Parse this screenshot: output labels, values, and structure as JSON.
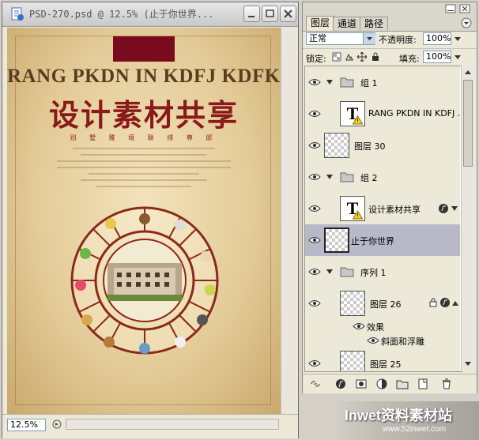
{
  "document": {
    "title": "PSD-270.psd @ 12.5% (止于你世界...",
    "zoom": "12.5%",
    "poster": {
      "english_title": "RANG PKDN IN KDFJ  KDFKD",
      "chinese_title": "设计素材共享",
      "subtitle": "别 墅 雅 境  联 排 尊 邸"
    }
  },
  "panel": {
    "tabs": [
      {
        "label": "图层"
      },
      {
        "label": "通道"
      },
      {
        "label": "路径"
      }
    ],
    "blend_mode": "正常",
    "opacity_label": "不透明度:",
    "opacity_value": "100%",
    "lock_label": "锁定:",
    "fill_label": "填充:",
    "fill_value": "100%",
    "layers": [
      {
        "name": "组 1"
      },
      {
        "name": "RANG PKDN IN KDFJ ..."
      },
      {
        "name": "图层 30"
      },
      {
        "name": "组 2"
      },
      {
        "name": "设计素材共享"
      },
      {
        "name": "止于你世界"
      },
      {
        "name": "序列 1"
      },
      {
        "name": "图层 26"
      },
      {
        "name": "效果"
      },
      {
        "name": "斜面和浮雕"
      },
      {
        "name": "图层 25"
      }
    ]
  },
  "watermark": {
    "brand": "Inwet资料素材站",
    "url": "www.52inwet.com"
  },
  "colors": {
    "poster_red": "#8a1a1a",
    "selected_row": "#b8b8c8",
    "panel_bg": "#ece9d8"
  }
}
